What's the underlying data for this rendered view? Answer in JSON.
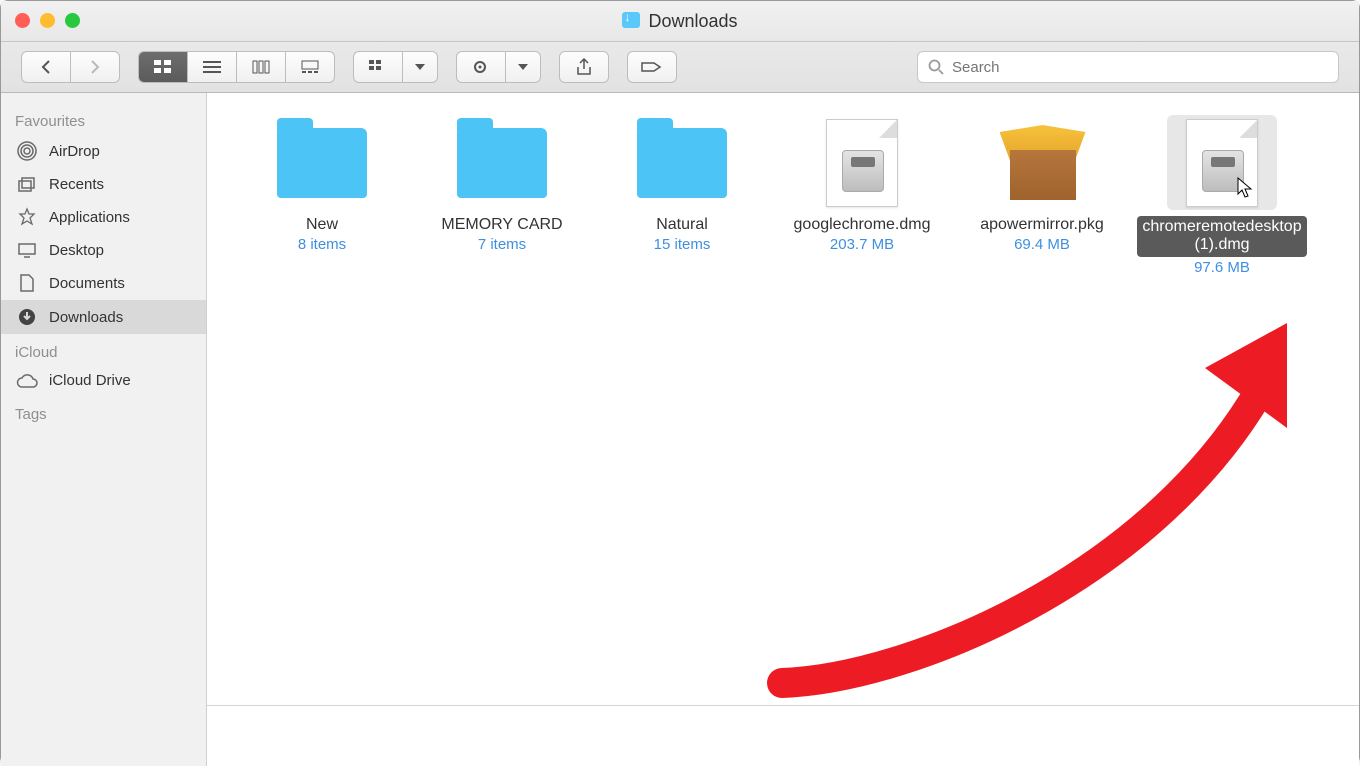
{
  "window_title": "Downloads",
  "search": {
    "placeholder": "Search"
  },
  "sidebar": {
    "sections": [
      {
        "title": "Favourites",
        "items": [
          {
            "icon": "airdrop",
            "label": "AirDrop"
          },
          {
            "icon": "recents",
            "label": "Recents"
          },
          {
            "icon": "apps",
            "label": "Applications"
          },
          {
            "icon": "desktop",
            "label": "Desktop"
          },
          {
            "icon": "documents",
            "label": "Documents"
          },
          {
            "icon": "downloads",
            "label": "Downloads",
            "selected": true
          }
        ]
      },
      {
        "title": "iCloud",
        "items": [
          {
            "icon": "cloud",
            "label": "iCloud Drive"
          }
        ]
      },
      {
        "title": "Tags",
        "items": []
      }
    ]
  },
  "items": [
    {
      "kind": "folder",
      "name": "New",
      "sub": "8 items"
    },
    {
      "kind": "folder",
      "name": "MEMORY CARD",
      "sub": "7 items"
    },
    {
      "kind": "folder",
      "name": "Natural",
      "sub": "15 items"
    },
    {
      "kind": "dmg",
      "name": "googlechrome.dmg",
      "sub": "203.7 MB"
    },
    {
      "kind": "pkg",
      "name": "apowermirror.pkg",
      "sub": "69.4 MB"
    },
    {
      "kind": "dmg",
      "name": "chromeremotedesktop (1).dmg",
      "sub": "97.6 MB",
      "selected": true,
      "cursor": true
    }
  ],
  "annotation": {
    "type": "arrow",
    "color": "#ed1c24"
  }
}
